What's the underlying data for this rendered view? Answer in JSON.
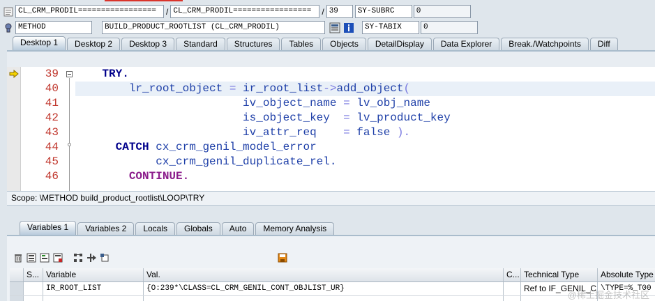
{
  "header": {
    "row1": {
      "program": "CL_CRM_PRODIL=================",
      "include": "CL_CRM_PRODIL=================",
      "line": "39",
      "sysvar_name": "SY-SUBRC",
      "sysvar_value": "0"
    },
    "row2": {
      "event_type": "METHOD",
      "event_name": "BUILD_PRODUCT_ROOTLIST (CL_CRM_PRODIL)",
      "sysvar_name": "SY-TABIX",
      "sysvar_value": "0"
    },
    "separator": "/"
  },
  "top_tabs": [
    {
      "label": "Desktop 1",
      "active": true
    },
    {
      "label": "Desktop 2"
    },
    {
      "label": "Desktop 3"
    },
    {
      "label": "Standard"
    },
    {
      "label": "Structures"
    },
    {
      "label": "Tables"
    },
    {
      "label": "Objects"
    },
    {
      "label": "DetailDisplay"
    },
    {
      "label": "Data Explorer"
    },
    {
      "label": "Break./Watchpoints"
    },
    {
      "label": "Diff"
    }
  ],
  "editor": {
    "line_numbers": [
      "39",
      "40",
      "41",
      "42",
      "43",
      "44",
      "45",
      "46"
    ],
    "current_line": "39",
    "code": {
      "l39_kw": "TRY.",
      "l40_var": "lr_root_object",
      "l40_eq": "=",
      "l40_obj": "ir_root_list",
      "l40_arrow": "->",
      "l40_meth": "add_object",
      "l40_paren": "(",
      "l41_param": "iv_object_name",
      "l41_eq": "=",
      "l41_val": "lv_obj_name",
      "l42_param": "is_object_key",
      "l42_eq": "=",
      "l42_val": "lv_product_key",
      "l43_param": "iv_attr_req",
      "l43_eq": "=",
      "l43_val": "false",
      "l43_close": ").",
      "l44_kw": "CATCH",
      "l44_cls": "cx_crm_genil_model_error",
      "l45_cls": "cx_crm_genil_duplicate_rel.",
      "l46_kw": "CONTINUE."
    }
  },
  "scope": {
    "text": "Scope: \\METHOD build_product_rootlist\\LOOP\\TRY"
  },
  "bottom_tabs": [
    {
      "label": "Variables 1",
      "active": true
    },
    {
      "label": "Variables 2"
    },
    {
      "label": "Locals"
    },
    {
      "label": "Globals"
    },
    {
      "label": "Auto"
    },
    {
      "label": "Memory Analysis"
    }
  ],
  "grid": {
    "columns": [
      "S...",
      "Variable",
      "Val.",
      "C...",
      "Technical Type",
      "Absolute Type"
    ],
    "rows": [
      {
        "variable": "IR_ROOT_LIST",
        "value": "{O:239*\\CLASS=CL_CRM_GENIL_CONT_OBJLIST_UR}",
        "c": "",
        "technical_type": "Ref to IF_GENIL_C...",
        "absolute_type": "\\TYPE=%_T00"
      }
    ]
  },
  "watermark": "@稀土掘金技术社区",
  "colors": {
    "line_number": "#c0362c",
    "keyword": "#00008b",
    "continue_keyword": "#8b1c8b",
    "identifier": "#1e3fa8",
    "operator": "#7a7ae0",
    "current_line_arrow": "#e3b800"
  },
  "icons": [
    "method-icon",
    "stack-icon",
    "info-icon",
    "current-line-arrow-icon",
    "delete-icon",
    "save-icon"
  ]
}
